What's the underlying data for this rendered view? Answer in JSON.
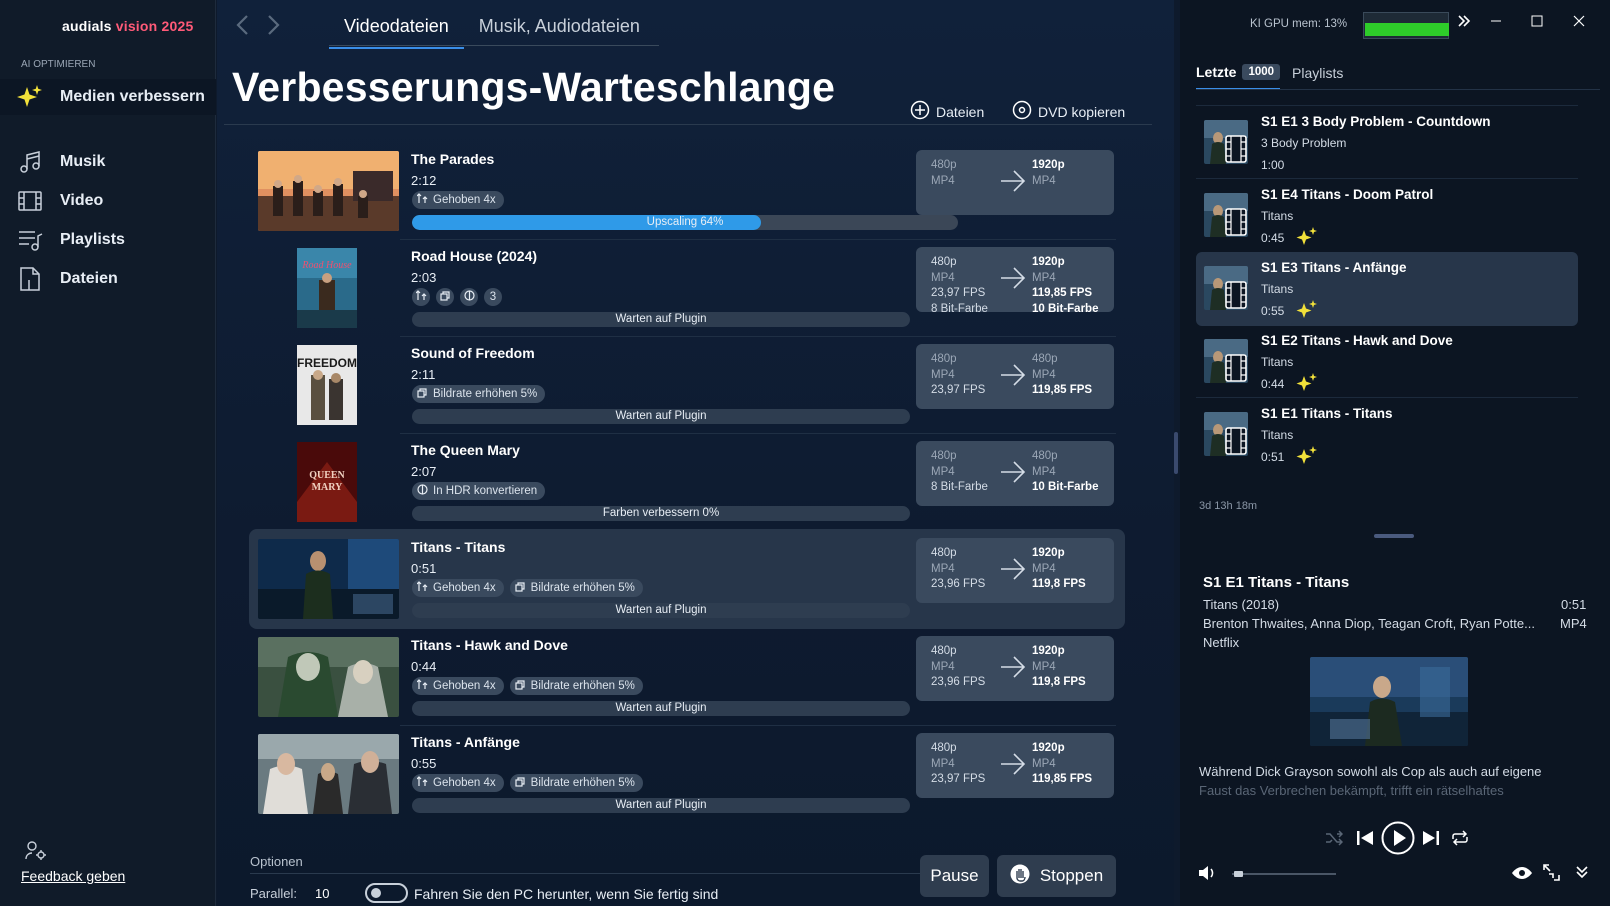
{
  "app": {
    "brand_name": "audials",
    "brand_accent": "vision 2025",
    "section": "AI OPTIMIEREN",
    "accent_color": "#2f9ae8"
  },
  "sidebar": {
    "items": [
      {
        "label": "Medien verbessern",
        "icon": "sparkle-icon",
        "active": true
      },
      {
        "label": "Musik",
        "icon": "music-note-icon"
      },
      {
        "label": "Video",
        "icon": "film-icon"
      },
      {
        "label": "Playlists",
        "icon": "playlist-icon"
      },
      {
        "label": "Dateien",
        "icon": "file-icon"
      }
    ],
    "feedback": "Feedback geben"
  },
  "header": {
    "tabs": [
      {
        "label": "Videodateien",
        "active": true
      },
      {
        "label": "Musik, Audiodateien"
      }
    ],
    "title": "Verbesserungs-Warteschlange",
    "add_files": "Dateien",
    "copy_dvd": "DVD kopieren"
  },
  "queue": [
    {
      "title": "The Parades",
      "duration": "2:12",
      "chips": [
        {
          "label": "Gehoben 4x",
          "icon": "upscale-icon"
        }
      ],
      "status": "Upscaling 64%",
      "progress": 0.64,
      "from": [
        "480p",
        "MP4"
      ],
      "to": [
        "1920p",
        "MP4"
      ]
    },
    {
      "title": "Road House (2024)",
      "duration": "2:03",
      "chips": [
        {
          "icon": "upscale-icon"
        },
        {
          "icon": "framerate-icon"
        },
        {
          "icon": "hdr-icon"
        },
        {
          "label": "3"
        }
      ],
      "status": "Warten auf Plugin",
      "from": [
        "480p",
        "MP4",
        "23,97 FPS",
        "8 Bit-Farbe"
      ],
      "to": [
        "1920p",
        "MP4",
        "119,85 FPS",
        "10 Bit-Farbe"
      ]
    },
    {
      "title": "Sound of Freedom",
      "duration": "2:11",
      "chips": [
        {
          "label": "Bildrate erhöhen 5%",
          "icon": "framerate-icon"
        }
      ],
      "status": "Warten auf Plugin",
      "from": [
        "480p",
        "MP4",
        "23,97 FPS"
      ],
      "to": [
        "480p",
        "MP4",
        "119,85 FPS"
      ]
    },
    {
      "title": "The Queen Mary",
      "duration": "2:07",
      "chips": [
        {
          "label": "In HDR konvertieren",
          "icon": "hdr-icon"
        }
      ],
      "status": "Farben verbessern 0%",
      "from": [
        "480p",
        "MP4",
        "8 Bit-Farbe"
      ],
      "to": [
        "480p",
        "MP4",
        "10 Bit-Farbe"
      ]
    },
    {
      "title": "Titans - Titans",
      "duration": "0:51",
      "chips": [
        {
          "label": "Gehoben 4x",
          "icon": "upscale-icon"
        },
        {
          "label": "Bildrate erhöhen 5%",
          "icon": "framerate-icon"
        }
      ],
      "status": "Warten auf Plugin",
      "from": [
        "480p",
        "MP4",
        "23,96 FPS"
      ],
      "to": [
        "1920p",
        "MP4",
        "119,8 FPS"
      ]
    },
    {
      "title": "Titans - Hawk and Dove",
      "duration": "0:44",
      "chips": [
        {
          "label": "Gehoben 4x",
          "icon": "upscale-icon"
        },
        {
          "label": "Bildrate erhöhen 5%",
          "icon": "framerate-icon"
        }
      ],
      "status": "Warten auf Plugin",
      "from": [
        "480p",
        "MP4",
        "23,96 FPS"
      ],
      "to": [
        "1920p",
        "MP4",
        "119,8 FPS"
      ]
    },
    {
      "title": "Titans - Anfänge",
      "duration": "0:55",
      "chips": [
        {
          "label": "Gehoben 4x",
          "icon": "upscale-icon"
        },
        {
          "label": "Bildrate erhöhen 5%",
          "icon": "framerate-icon"
        }
      ],
      "status": "Warten auf Plugin",
      "from": [
        "480p",
        "MP4",
        "23,97 FPS"
      ],
      "to": [
        "1920p",
        "MP4",
        "119,85 FPS"
      ]
    }
  ],
  "options": {
    "label": "Optionen",
    "parallel_label": "Parallel:",
    "parallel_value": "10",
    "shutdown_label": "Fahren Sie den PC herunter, wenn Sie fertig sind",
    "shutdown_enabled": false,
    "pause": "Pause",
    "stop": "Stoppen"
  },
  "right": {
    "gpu_label": "KI GPU mem: 13%",
    "gpu_level": 0.13,
    "tabs": [
      {
        "label": "Letzte",
        "badge": "1000",
        "active": true
      },
      {
        "label": "Playlists"
      }
    ],
    "history": [
      {
        "title": "S1 E1 3 Body Problem - Countdown",
        "sub": "3 Body Problem",
        "duration": "1:00",
        "enhanced": false
      },
      {
        "title": "S1 E4 Titans - Doom Patrol",
        "sub": "Titans",
        "duration": "0:45",
        "enhanced": true
      },
      {
        "title": "S1 E3 Titans - Anfänge",
        "sub": "Titans",
        "duration": "0:55",
        "enhanced": true,
        "selected": true
      },
      {
        "title": "S1 E2 Titans - Hawk and Dove",
        "sub": "Titans",
        "duration": "0:44",
        "enhanced": true
      },
      {
        "title": "S1 E1 Titans - Titans",
        "sub": "Titans",
        "duration": "0:51",
        "enhanced": true
      }
    ],
    "ago": "3d 13h 18m",
    "detail": {
      "title": "S1  E1  Titans - Titans",
      "series_year": "Titans  (2018)",
      "duration": "0:51",
      "cast": "Brenton Thwaites, Anna Diop, Teagan Croft, Ryan Potte...",
      "format": "MP4",
      "network": "Netflix",
      "desc1": "Während Dick Grayson sowohl als Cop als auch auf eigene",
      "desc2": "Faust das Verbrechen bekämpft, trifft ein rätselhaftes"
    },
    "volume": 0.02
  }
}
